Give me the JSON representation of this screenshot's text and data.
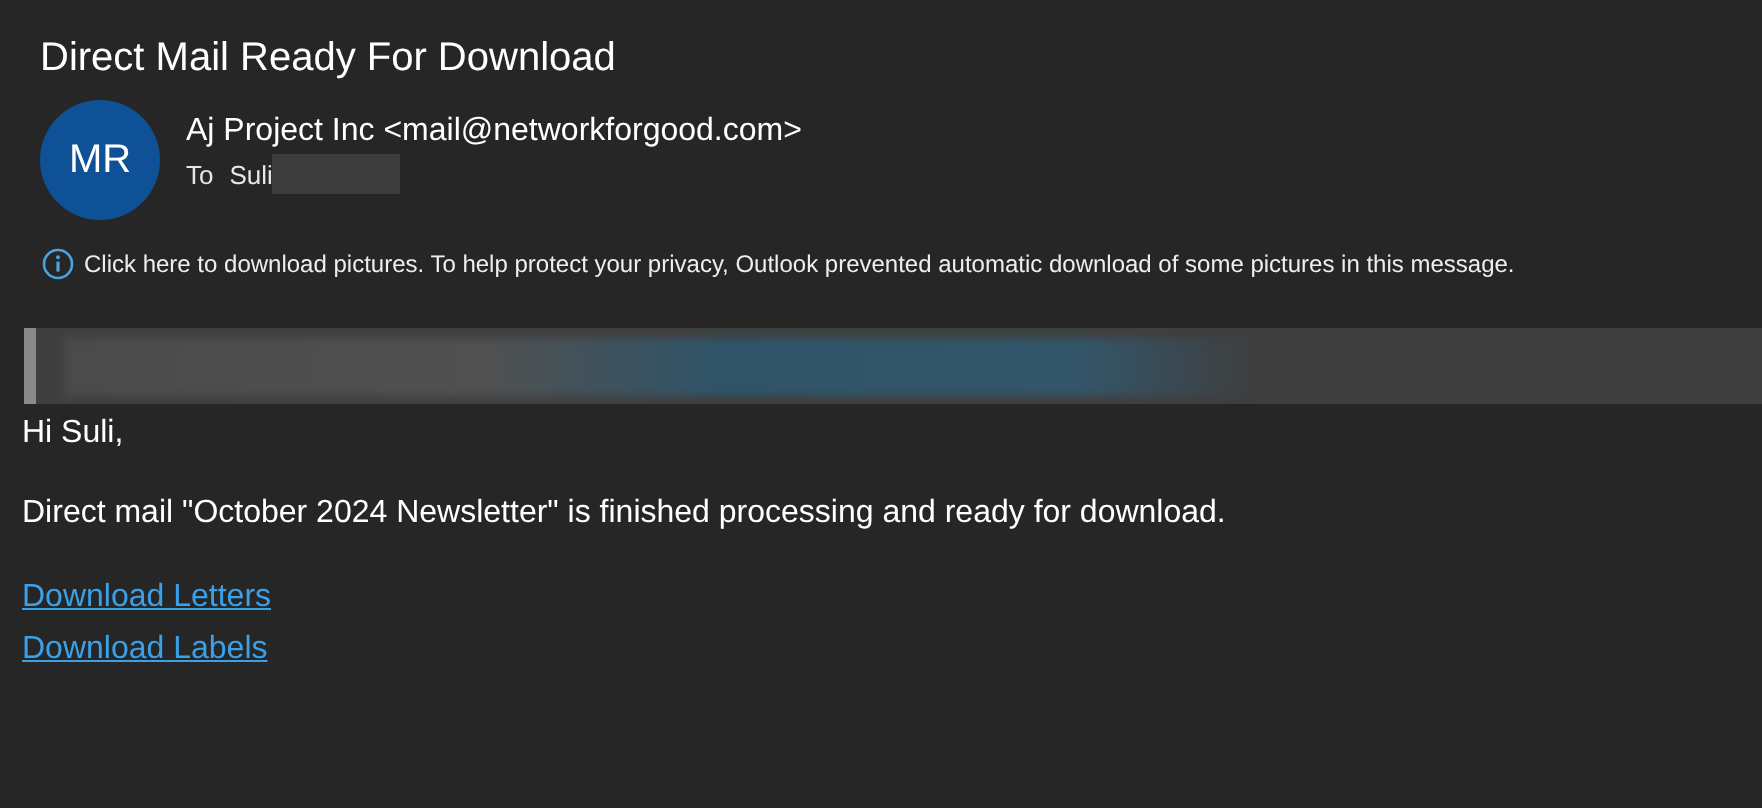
{
  "subject": "Direct Mail Ready For Download",
  "sender": {
    "initials": "MR",
    "name": "Aj Project Inc <mail@networkforgood.com>",
    "to_label": "To",
    "recipient": "Suli"
  },
  "info_bar": {
    "text": "Click here to download pictures. To help protect your privacy, Outlook prevented automatic download of some pictures in this message."
  },
  "body": {
    "greeting": "Hi Suli,",
    "message": "Direct mail \"October 2024 Newsletter\" is finished processing and ready for download.",
    "links": [
      "Download Letters",
      "Download Labels"
    ]
  }
}
